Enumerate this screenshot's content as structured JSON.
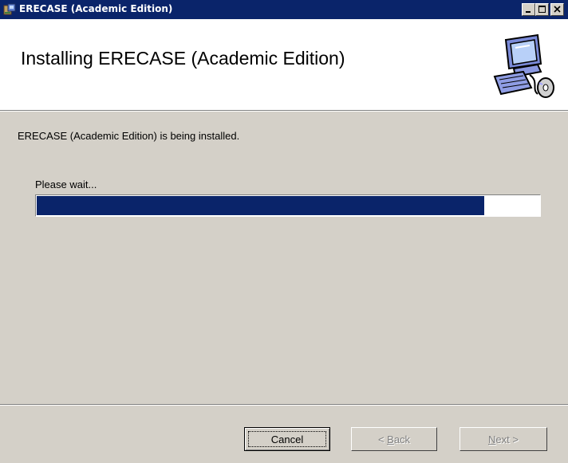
{
  "window": {
    "title": "ERECASE (Academic Edition)",
    "controls": [
      "minimize-icon",
      "maximize-icon",
      "close-icon"
    ]
  },
  "header": {
    "title": "Installing ERECASE (Academic Edition)",
    "logo_icon": "computer-cd-icon"
  },
  "body": {
    "message": "ERECASE (Academic Edition) is being installed.",
    "wait_label": "Please wait...",
    "progress_percent": 89
  },
  "footer": {
    "cancel_label": "Cancel",
    "back_label": "< Back",
    "next_label": "Next >",
    "back_enabled": false,
    "next_enabled": false
  },
  "colors": {
    "titlebar": "#0a246a",
    "progress": "#0a246a",
    "face": "#d4d0c8"
  }
}
